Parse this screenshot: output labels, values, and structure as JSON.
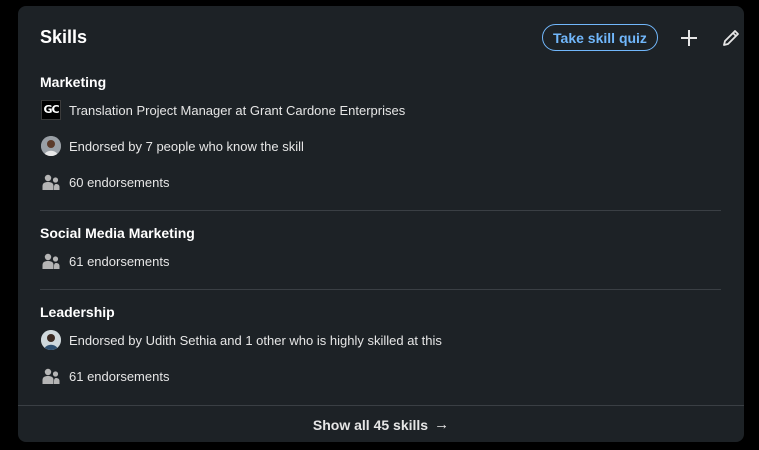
{
  "section": {
    "title": "Skills",
    "quiz_button": "Take skill quiz"
  },
  "skills": [
    {
      "name": "Marketing",
      "company": "Translation Project Manager at Grant Cardone Enterprises",
      "company_logo_text": "GC",
      "endorsed_by": "Endorsed by 7 people who know the skill",
      "endorsements": "60 endorsements"
    },
    {
      "name": "Social Media Marketing",
      "endorsements": "61 endorsements"
    },
    {
      "name": "Leadership",
      "endorsed_by": "Endorsed by Udith Sethia and 1 other who is highly skilled at this",
      "endorsements": "61 endorsements"
    }
  ],
  "footer": {
    "show_all": "Show all 45 skills",
    "arrow": "→"
  },
  "colors": {
    "card_bg": "#1d2226",
    "accent": "#71b7fb",
    "divider": "#3a3f44"
  }
}
